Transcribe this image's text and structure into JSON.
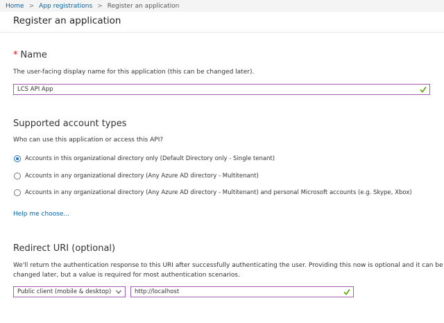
{
  "breadcrumb": {
    "home": "Home",
    "app_registrations": "App registrations",
    "current": "Register an application"
  },
  "page": {
    "title": "Register an application"
  },
  "name_section": {
    "required_mark": "*",
    "title": "Name",
    "description": "The user-facing display name for this application (this can be changed later).",
    "value": "LCS API App"
  },
  "account_types": {
    "title": "Supported account types",
    "question": "Who can use this application or access this API?",
    "options": [
      {
        "label": "Accounts in this organizational directory only (Default Directory only - Single tenant)",
        "selected": true
      },
      {
        "label": "Accounts in any organizational directory (Any Azure AD directory - Multitenant)",
        "selected": false
      },
      {
        "label": "Accounts in any organizational directory (Any Azure AD directory - Multitenant) and personal Microsoft accounts (e.g. Skype, Xbox)",
        "selected": false
      }
    ],
    "help_link": "Help me choose..."
  },
  "redirect": {
    "title": "Redirect URI (optional)",
    "description_line1": "We'll return the authentication response to this URI after successfully authenticating the user. Providing this now is optional and it can be",
    "description_line2": "changed later, but a value is required for most authentication scenarios.",
    "platform_selected": "Public client (mobile & desktop)",
    "uri_value": "http://localhost"
  },
  "colors": {
    "accent_link": "#0062ad",
    "focus_border": "#a45bb4",
    "valid_check": "#57a300",
    "required": "#e00b1c",
    "radio_selected": "#1a6fc4"
  }
}
